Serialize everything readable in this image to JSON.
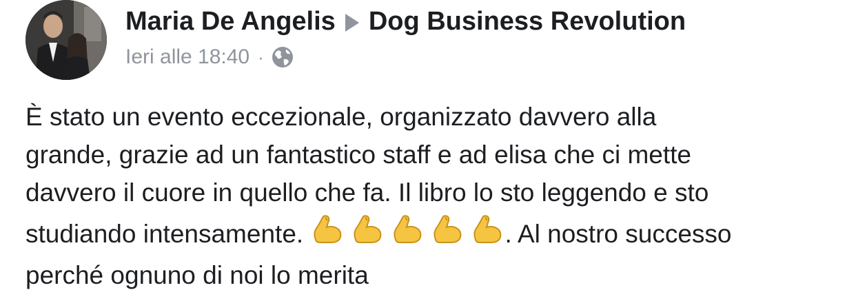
{
  "post": {
    "author": "Maria De Angelis",
    "group": "Dog Business Revolution",
    "timestamp": "Ieri alle 18:40",
    "separator": "·",
    "privacy_icon": "globe-icon",
    "avatar_icon": "profile-photo",
    "body": {
      "line1": "È stato un evento eccezionale, organizzato davvero alla",
      "line2": "grande, grazie ad un fantastico staff e ad elisa che ci mette",
      "line3": "davvero il cuore in quello che fa. Il libro lo sto leggendo e sto",
      "line4_start": "studiando intensamente. ",
      "emoji": [
        "💪",
        "💪",
        "💪",
        "💪",
        "💪"
      ],
      "line4_end": ". Al nostro successo",
      "line5": "perché ognuno di noi lo merita"
    }
  },
  "colors": {
    "text": "#1c1e21",
    "meta": "#90949c",
    "emoji": "#f2c94c"
  }
}
